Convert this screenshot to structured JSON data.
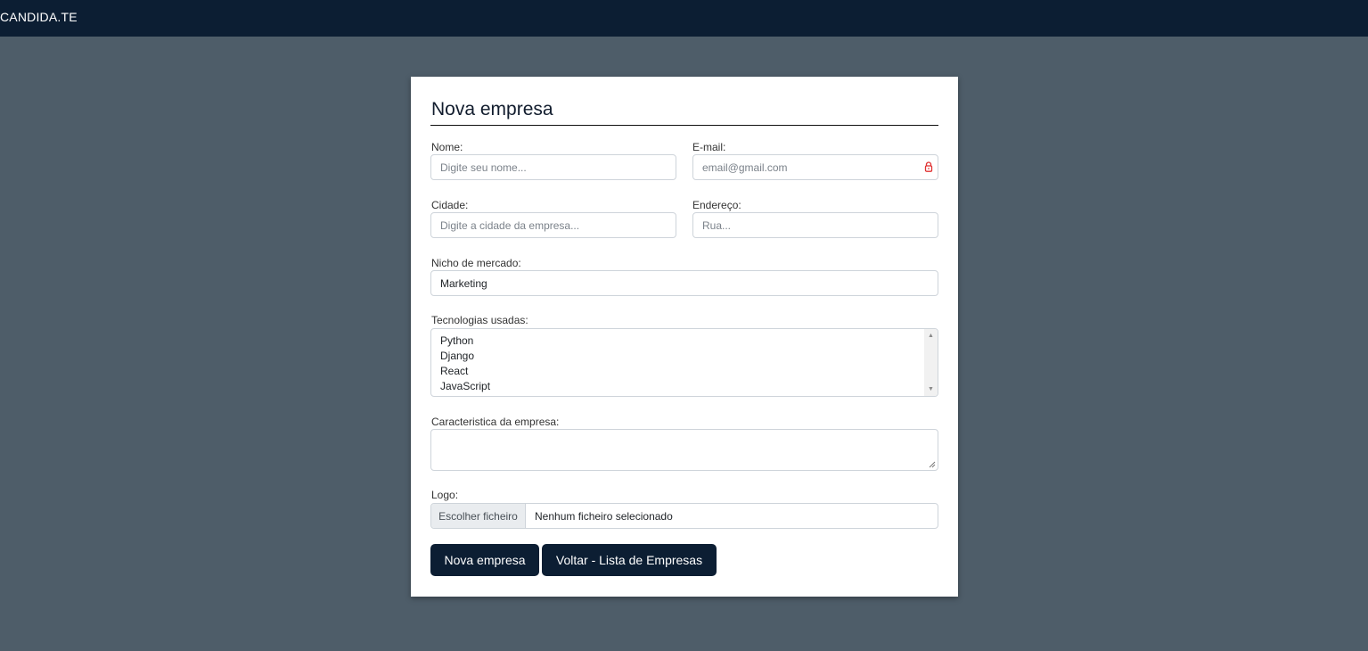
{
  "navbar": {
    "brand": "CANDIDA.TE"
  },
  "form": {
    "title": "Nova empresa",
    "nome": {
      "label": "Nome:",
      "placeholder": "Digite seu nome..."
    },
    "email": {
      "label": "E-mail:",
      "placeholder": "email@gmail.com",
      "icon": "password-manager-lock-icon"
    },
    "cidade": {
      "label": "Cidade:",
      "placeholder": "Digite a cidade da empresa..."
    },
    "endereco": {
      "label": "Endereço:",
      "placeholder": "Rua..."
    },
    "nicho": {
      "label": "Nicho de mercado:",
      "value": "Marketing"
    },
    "tecnologias": {
      "label": "Tecnologias usadas:",
      "options": [
        "Python",
        "Django",
        "React",
        "JavaScript"
      ]
    },
    "caracteristica": {
      "label": "Caracteristica da empresa:",
      "value": ""
    },
    "logo": {
      "label": "Logo:",
      "button": "Escolher ficheiro",
      "status": "Nenhum ficheiro selecionado"
    },
    "buttons": {
      "submit": "Nova empresa",
      "back": "Voltar - Lista de Empresas"
    }
  },
  "colors": {
    "navbar": "#0c1e33",
    "background": "#4e5d69",
    "button": "#0c1e33",
    "accent_icon": "#e03131"
  }
}
